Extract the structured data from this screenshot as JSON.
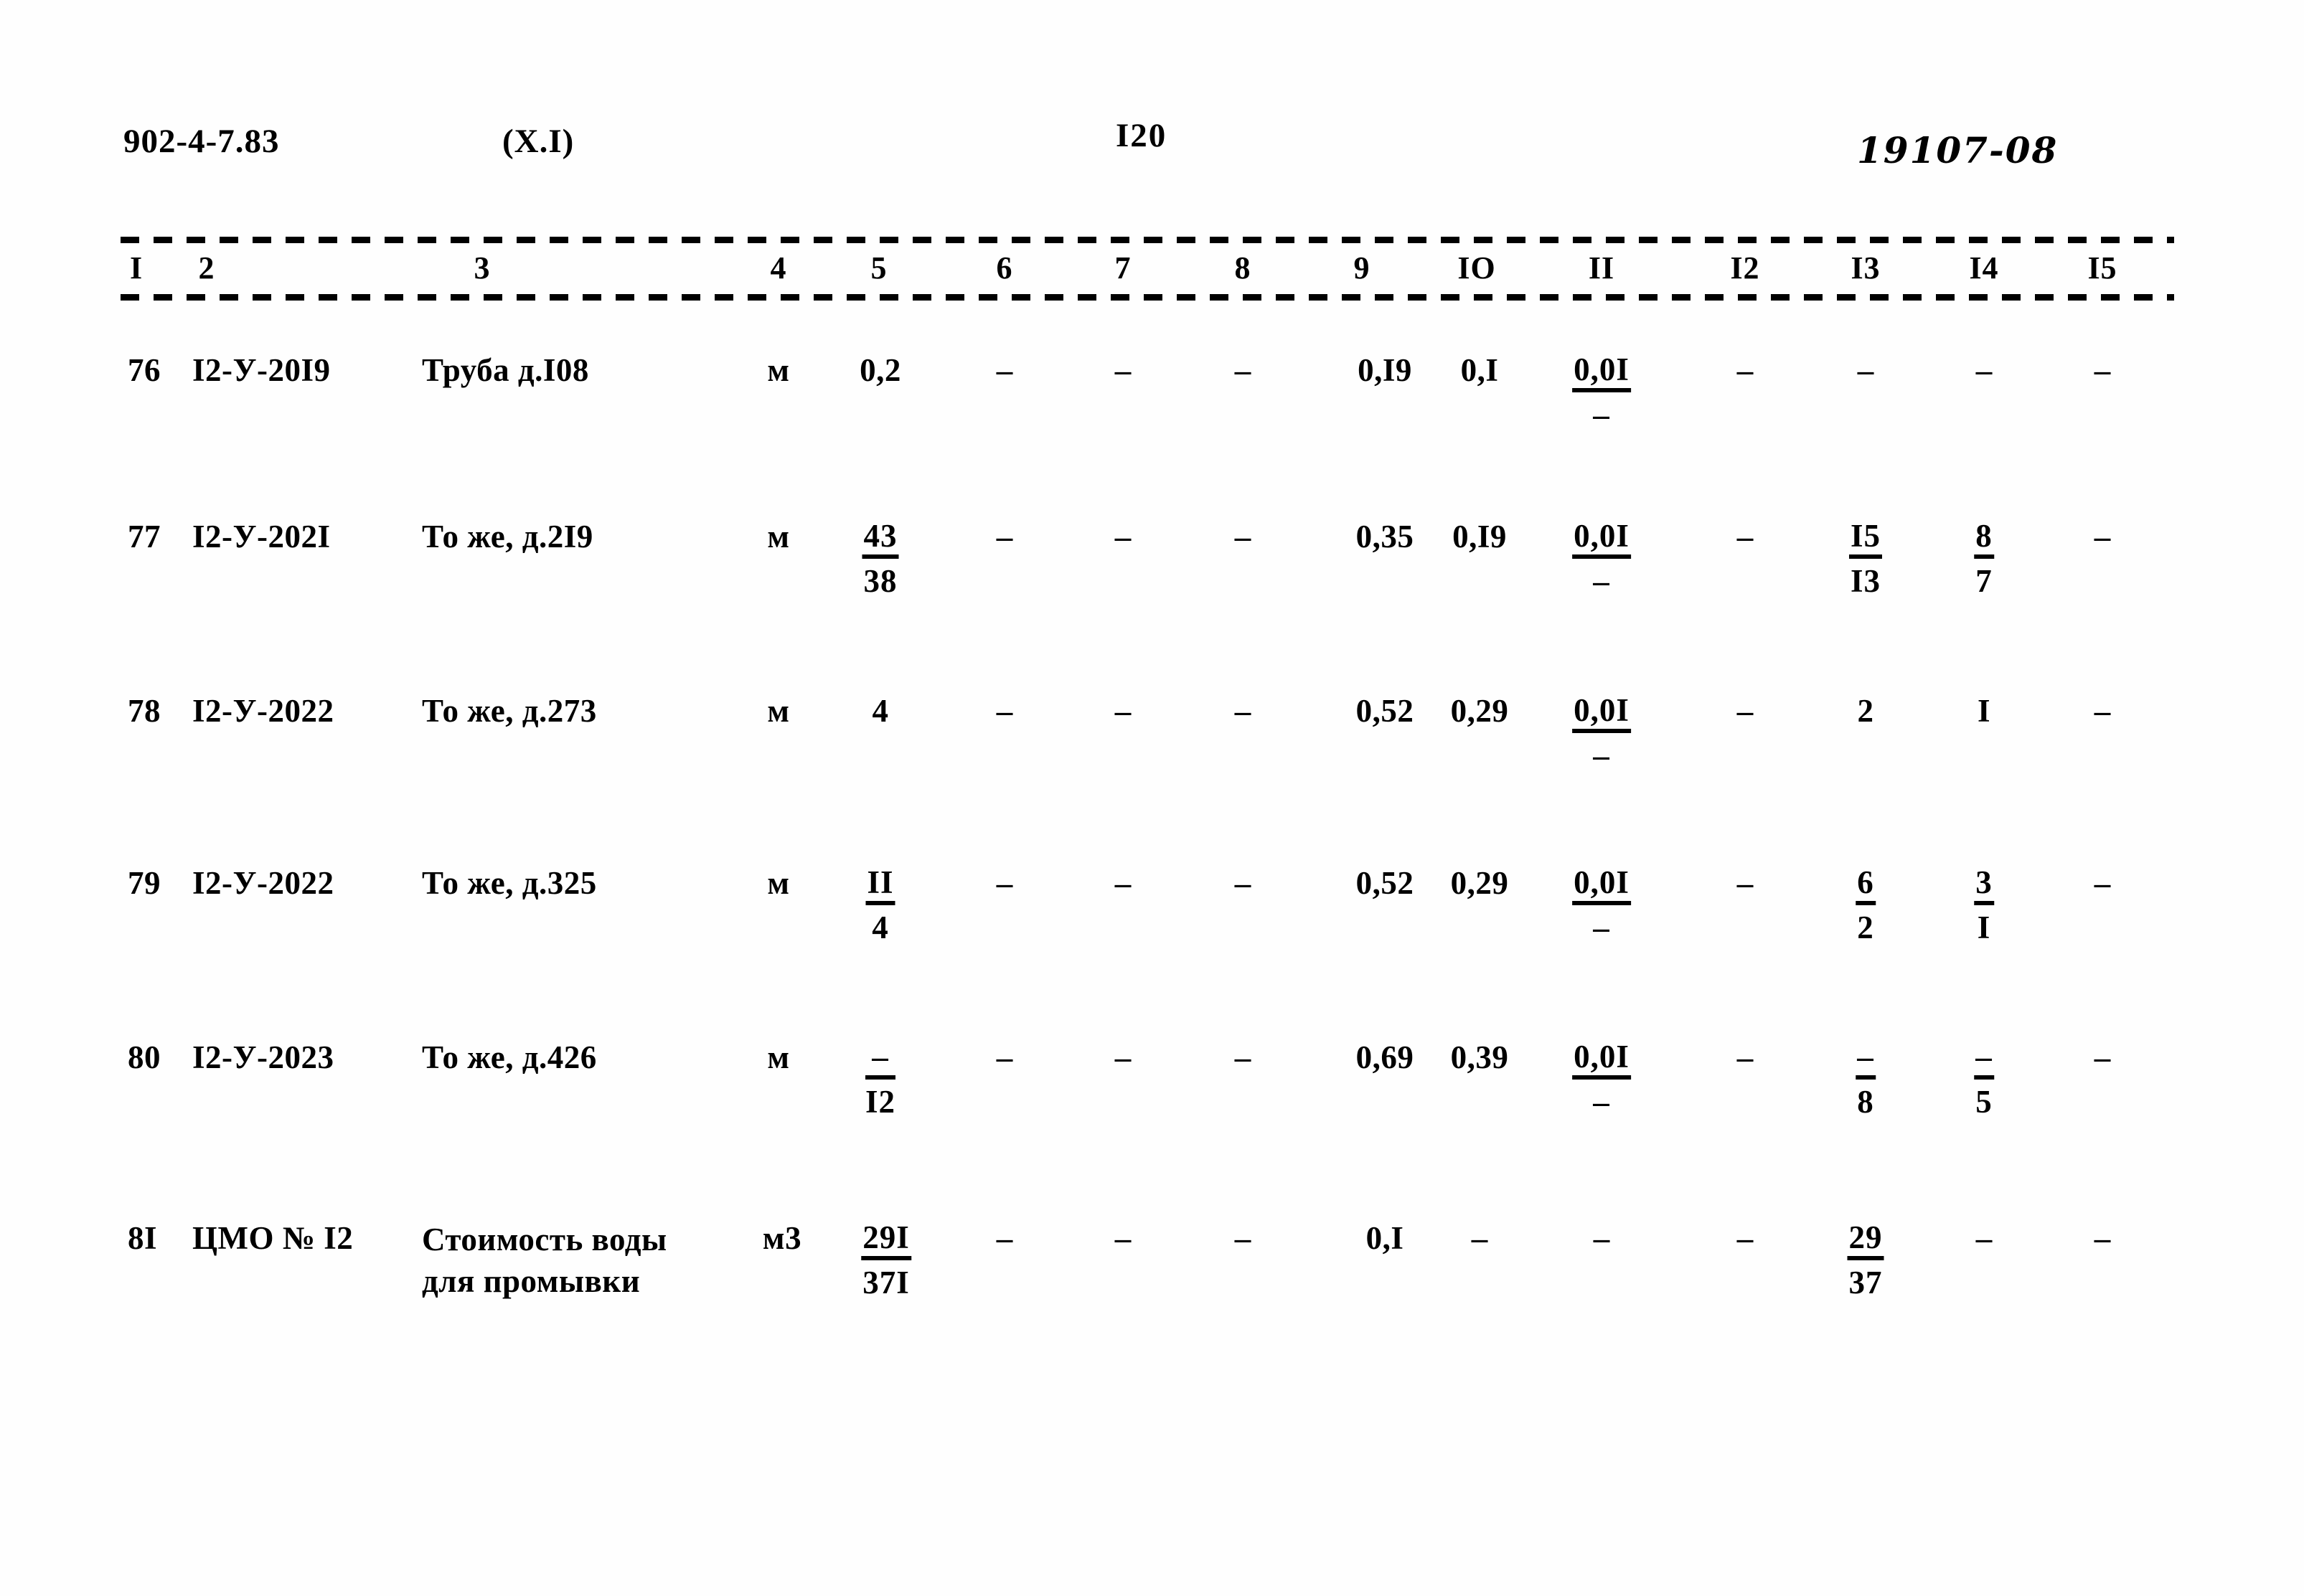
{
  "header": {
    "document_code": "902-4-7.83",
    "section": "(X.I)",
    "page_number": "I20",
    "stamp": "19107-08"
  },
  "table": {
    "column_headers": [
      "I",
      "2",
      "3",
      "4",
      "5",
      "6",
      "7",
      "8",
      "9",
      "IO",
      "II",
      "I2",
      "I3",
      "I4",
      "I5"
    ],
    "rows": [
      {
        "num": "76",
        "code": "I2-У-20I9",
        "name": "Труба д.I08",
        "unit": "м",
        "c5": "0,2",
        "c6": "–",
        "c7": "–",
        "c8": "–",
        "c9": "0,I9",
        "c10": "0,I",
        "c11_num": "0,0I",
        "c11_den": "–",
        "c12": "–",
        "c13": "–",
        "c14": "–",
        "c15": "–"
      },
      {
        "num": "77",
        "code": "I2-У-202I",
        "name": "То же, д.2I9",
        "unit": "м",
        "c5_num": "43",
        "c5_den": "38",
        "c6": "–",
        "c7": "–",
        "c8": "–",
        "c9": "0,35",
        "c10": "0,I9",
        "c11_num": "0,0I",
        "c11_den": "–",
        "c12": "–",
        "c13_num": "I5",
        "c13_den": "I3",
        "c14_num": "8",
        "c14_den": "7",
        "c15": "–"
      },
      {
        "num": "78",
        "code": "I2-У-2022",
        "name": "То же, д.273",
        "unit": "м",
        "c5": "4",
        "c6": "–",
        "c7": "–",
        "c8": "–",
        "c9": "0,52",
        "c10": "0,29",
        "c11_num": "0,0I",
        "c11_den": "–",
        "c12": "–",
        "c13": "2",
        "c14": "I",
        "c15": "–"
      },
      {
        "num": "79",
        "code": "I2-У-2022",
        "name": "То же, д.325",
        "unit": "м",
        "c5_num": "II",
        "c5_den": "4",
        "c6": "–",
        "c7": "–",
        "c8": "–",
        "c9": "0,52",
        "c10": "0,29",
        "c11_num": "0,0I",
        "c11_den": "–",
        "c12": "–",
        "c13_num": "6",
        "c13_den": "2",
        "c14_num": "3",
        "c14_den": "I",
        "c15": "–"
      },
      {
        "num": "80",
        "code": "I2-У-2023",
        "name": "То же, д.426",
        "unit": "м",
        "c5_num": "–",
        "c5_den": "I2",
        "c6": "–",
        "c7": "–",
        "c8": "–",
        "c9": "0,69",
        "c10": "0,39",
        "c11_num": "0,0I",
        "c11_den": "–",
        "c12": "–",
        "c13_num": "–",
        "c13_den": "8",
        "c14_num": "–",
        "c14_den": "5",
        "c15": "–"
      },
      {
        "num": "8I",
        "code": "ЦМО № I2",
        "name_line1": "Стоимость воды",
        "name_line2": "для промывки",
        "unit": "м3",
        "c5_num": "29I",
        "c5_den": "37I",
        "c6": "–",
        "c7": "–",
        "c8": "–",
        "c9": "0,I",
        "c10": "–",
        "c11": "–",
        "c12": "–",
        "c13_num": "29",
        "c13_den": "37",
        "c14": "–",
        "c15": "–"
      }
    ]
  }
}
